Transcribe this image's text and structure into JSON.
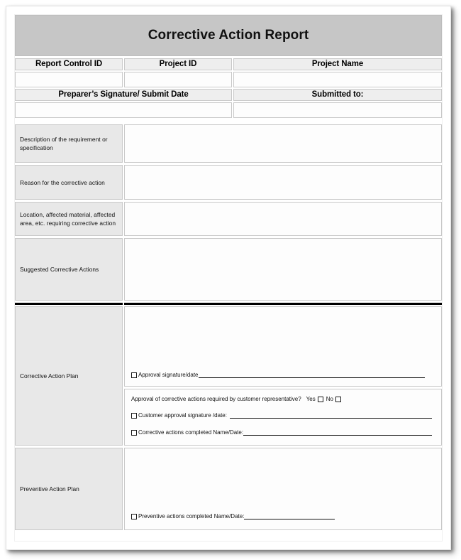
{
  "document": {
    "title": "Corrective Action Report"
  },
  "header": {
    "row1": [
      {
        "label": "Report Control ID",
        "value": ""
      },
      {
        "label": "Project ID",
        "value": ""
      },
      {
        "label": "Project Name",
        "value": ""
      }
    ],
    "row2": [
      {
        "label": "Preparer’s Signature/ Submit Date",
        "value": ""
      },
      {
        "label": "Submitted to:",
        "value": ""
      }
    ]
  },
  "body_rows": [
    {
      "label": "Description of the requirement or specification",
      "value": ""
    },
    {
      "label": "Reason for the corrective action",
      "value": ""
    },
    {
      "label": "Location, affected material, affected area, etc. requiring  corrective action",
      "value": ""
    },
    {
      "label": "Suggested Corrective Actions",
      "value": ""
    }
  ],
  "corrective_action_plan": {
    "label": "Corrective Action Plan",
    "notes": "",
    "approval_line": {
      "checkbox_label": "Approval signature/date",
      "value": ""
    },
    "customer_block": {
      "question": "Approval of corrective actions required by customer representative?",
      "yes_label": "Yes",
      "no_label": "No",
      "yes_checked": false,
      "no_checked": false,
      "lines": [
        {
          "checkbox_label": "Customer approval signature /date:",
          "value": ""
        },
        {
          "checkbox_label": "Corrective actions completed Name/Date:",
          "value": ""
        }
      ]
    }
  },
  "preventive_action_plan": {
    "label": "Preventive Action Plan",
    "notes": "",
    "completed_line": {
      "checkbox_label": "Preventive actions completed Name/Date:",
      "value": ""
    }
  },
  "colors": {
    "title_background": "#c6c6c6",
    "header_cell_background": "#eeeeee",
    "label_cell_background": "#e8e8e8",
    "field_background": "#fdfdfd",
    "border": "#c9c9c9",
    "rule": "#111111"
  }
}
